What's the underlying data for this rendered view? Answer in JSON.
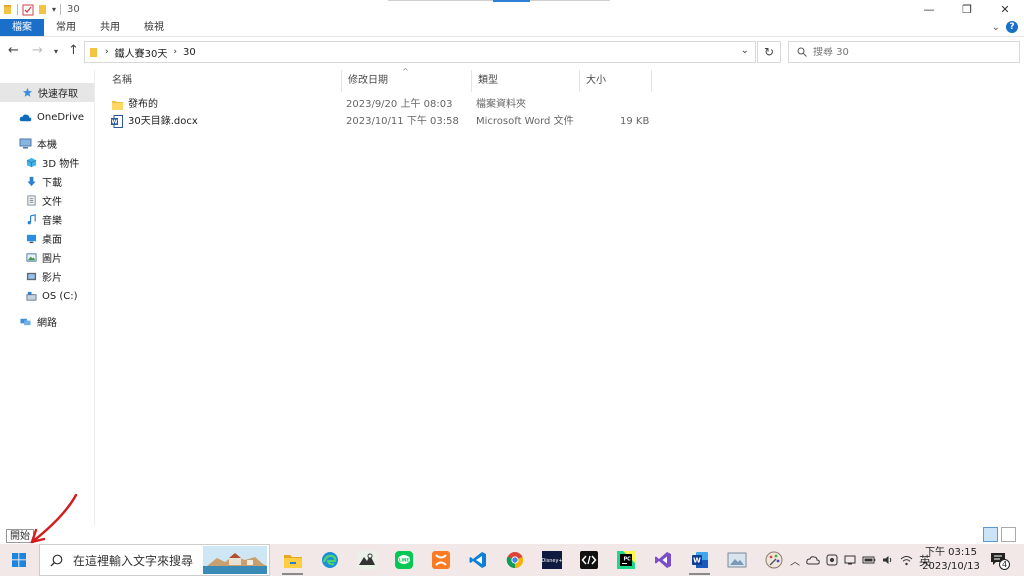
{
  "window": {
    "title": "30"
  },
  "ribbon": {
    "tabs": [
      "檔案",
      "常用",
      "共用",
      "檢視"
    ],
    "active_tab": "檔案"
  },
  "address": {
    "crumbs": [
      "鐵人賽30天",
      "30"
    ]
  },
  "search": {
    "placeholder": "搜尋 30"
  },
  "nav": {
    "items": [
      {
        "label": "快速存取",
        "icon": "star-icon"
      },
      {
        "label": "OneDrive",
        "icon": "cloud-icon"
      },
      {
        "label": "本機",
        "icon": "computer-icon"
      },
      {
        "label": "3D 物件",
        "icon": "cube-icon"
      },
      {
        "label": "下載",
        "icon": "download-icon"
      },
      {
        "label": "文件",
        "icon": "document-icon"
      },
      {
        "label": "音樂",
        "icon": "music-icon"
      },
      {
        "label": "桌面",
        "icon": "desktop-icon"
      },
      {
        "label": "圖片",
        "icon": "picture-icon"
      },
      {
        "label": "影片",
        "icon": "video-icon"
      },
      {
        "label": "OS (C:)",
        "icon": "drive-icon"
      },
      {
        "label": "網路",
        "icon": "network-icon"
      }
    ]
  },
  "columns": {
    "name": "名稱",
    "date": "修改日期",
    "type": "類型",
    "size": "大小"
  },
  "files": [
    {
      "name": "發布的",
      "date": "2023/9/20 上午 08:03",
      "type": "檔案資料夾",
      "size": "",
      "icon": "folder-icon"
    },
    {
      "name": "30天目錄.docx",
      "date": "2023/10/11 下午 03:58",
      "type": "Microsoft Word 文件",
      "size": "19 KB",
      "icon": "word-doc-icon"
    }
  ],
  "tooltip": {
    "text": "開始"
  },
  "taskbar": {
    "search_placeholder": "在這裡輸入文字來搜尋",
    "ime": "英",
    "time": "下午 03:15",
    "date": "2023/10/13",
    "notifications": "4"
  },
  "colors": {
    "accent": "#1a6fc9",
    "taskbar": "#f2e8e8"
  }
}
